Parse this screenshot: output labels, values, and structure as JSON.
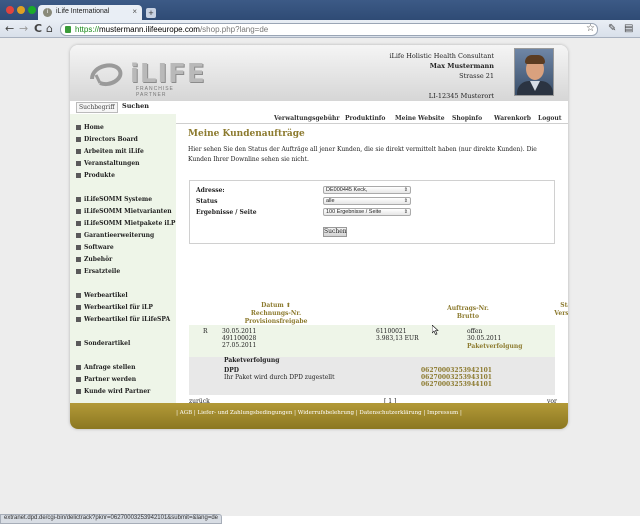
{
  "browser": {
    "tab_title": "iLife International",
    "tab_close": "×",
    "new_tab": "+",
    "url_scheme": "https://",
    "url_host": "mustermann.ilifeeurope.com",
    "url_path": "/shop.php?lang=de",
    "back": "←",
    "forward": "→",
    "reload": "C",
    "home": "⌂",
    "star": "☆",
    "wrench": "✎",
    "status_url": "extranet.dpd.de/cgi-bin/delictrack?pknr=06270003253942101&submit=&lang=de"
  },
  "logo": {
    "text": "iLIFE",
    "tagline": "FRANCHISE PARTNER"
  },
  "consultant": {
    "role": "iLife Holistic Health Consultant",
    "name": "Max Mustermann",
    "street": "Strasse 21",
    "city": "LI-12345 Musterort"
  },
  "search": {
    "placeholder": "Suchbegriff",
    "button": "Suchen"
  },
  "topnav": [
    "Verwaltungsgebühr",
    "Produktinfo",
    "Meine Website",
    "Shopinfo",
    "Warenkorb",
    "Logout"
  ],
  "sidebar": [
    "Home",
    "Directors Board",
    "Arbeiten mit iLife",
    "Veranstaltungen",
    "Produkte",
    "iLifeSOMM Systeme",
    "iLifeSOMM Mietvarianten",
    "iLifeSOMM Mietpakete iLP",
    "Garantieerweiterung",
    "Software",
    "Zubehör",
    "Ersatzteile",
    "Werbeartikel",
    "Werbeartikel für iLP",
    "Werbeartikel für iLifeSPA",
    "Sonderartikel",
    "Anfrage stellen",
    "Partner werden",
    "Kunde wird Partner"
  ],
  "main": {
    "title": "Meine Kundenaufträge",
    "intro": "Hier sehen Sie den Status der Aufträge all jener Kunden, die sie direkt vermittelt haben (nur direkte Kunden). Die Kunden Ihrer Downline sehen sie nicht.",
    "filter": {
      "address_label": "Adresse:",
      "address_value": "DE000445 Keck,",
      "status_label": "Status",
      "status_value": "alle",
      "per_page_label": "Ergebnisse / Seite",
      "per_page_value": "100 Ergebnisse / Seite",
      "submit": "Suchen"
    },
    "table_head": {
      "col1_line1": "Datum ⬆",
      "col1_line2": "Rechnungs-Nr.",
      "col1_line3": "Provisionsfreigabe",
      "col2_line1": "Auftrags-Nr.",
      "col2_line2": "Brutto",
      "col3_line1": "Status",
      "col3_line2": "Versendet"
    },
    "row": {
      "flag": "R",
      "date": "30.05.2011",
      "invoice": "491100028",
      "commission_date": "27.05.2011",
      "order_no": "61100021",
      "gross": "3.983,13 EUR",
      "status": "offen",
      "shipped": "30.05.2011",
      "tracking_link": "Paketverfolgung"
    },
    "detail": {
      "heading": "Paketverfolgung",
      "carrier": "DPD",
      "note": "Ihr Paket wird durch DPD zugestellt",
      "tracking": [
        "06270003253942101",
        "06270003253943101",
        "06270003253944101"
      ]
    },
    "pager": {
      "back": "zurück",
      "page": "[ 1 ]",
      "next": "vor"
    }
  },
  "footer": {
    "text": "| AGB | Liefer- und Zahlungsbedingungen | Widerrufsbelehrung | Datenschutzerklärung | Impressum |"
  },
  "colors": {
    "gold": "#8c7a2e",
    "footer": "#a38d2e",
    "sidebar": "#eef5e8"
  }
}
